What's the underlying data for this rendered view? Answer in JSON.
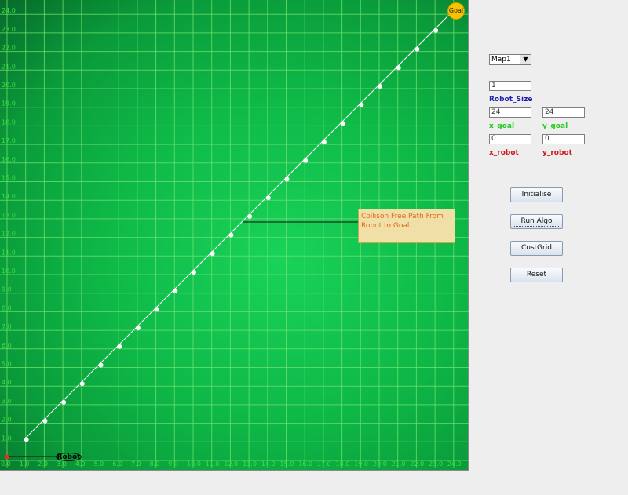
{
  "plot": {
    "x_ticks": [
      "0.0",
      "1.0",
      "2.0",
      "3.0",
      "4.0",
      "5.0",
      "6.0",
      "7.0",
      "8.0",
      "9.0",
      "10.0",
      "11.0",
      "12.0",
      "13.0",
      "14.0",
      "15.0",
      "16.0",
      "17.0",
      "18.0",
      "19.0",
      "20.0",
      "21.0",
      "22.0",
      "23.0",
      "24.0"
    ],
    "y_ticks": [
      "1.0",
      "2.0",
      "3.0",
      "4.0",
      "5.0",
      "6.0",
      "7.0",
      "8.0",
      "9.0",
      "10.0",
      "11.0",
      "12.0",
      "13.0",
      "14.0",
      "15.0",
      "16.0",
      "17.0",
      "18.0",
      "19.0",
      "20.0",
      "21.0",
      "22.0",
      "23.0",
      "24.0"
    ],
    "path_points": [
      1,
      2,
      3,
      4,
      5,
      6,
      7,
      8,
      9,
      10,
      11,
      12,
      13,
      14,
      15,
      16,
      17,
      18,
      19,
      20,
      21,
      22,
      23
    ],
    "robot_label": "Robot",
    "goal_label": "Goal",
    "annotation": "Collison Free Path From Robot to Goal.",
    "colors": {
      "grid": "#6ee46e",
      "tick_text": "#3be03b",
      "path": "#ffffff",
      "robot_marker": "#ff2020",
      "goal": "#f5c400",
      "annotation_bg": "#f0e0a8",
      "annotation_text": "#e06a1a"
    }
  },
  "controls": {
    "map_select": "Map1",
    "robot_size_value": "1",
    "robot_size_label": "Robot_Size",
    "x_goal_value": "24",
    "y_goal_value": "24",
    "x_goal_label": "x_goal",
    "y_goal_label": "y_goal",
    "x_robot_value": "0",
    "y_robot_value": "0",
    "x_robot_label": "x_robot",
    "y_robot_label": "y_robot",
    "buttons": {
      "initialise": "Initialise",
      "run_algo": "Run Algo",
      "cost_grid": "CostGrid",
      "reset": "Reset"
    },
    "colors": {
      "robot_size_label": "#2020b0",
      "goal_label": "#22cc22",
      "robot_label": "#cc1a1a"
    }
  }
}
